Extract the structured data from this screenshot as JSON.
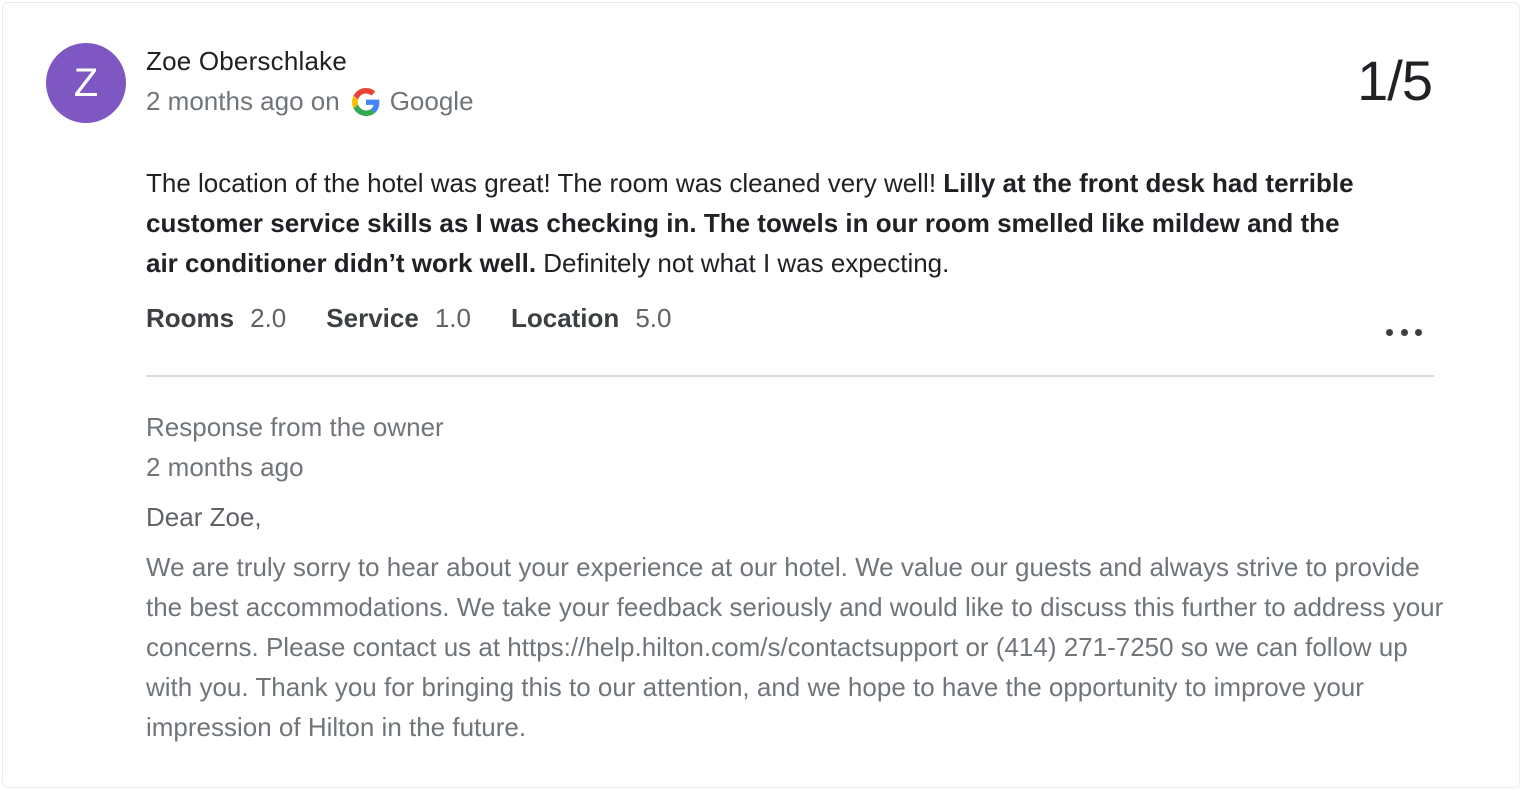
{
  "reviewer": {
    "initial": "Z",
    "name": "Zoe Oberschlake",
    "avatar_color": "#7e57c2"
  },
  "meta": {
    "time_prefix": "2 months ago on",
    "source_icon": "google-g-icon",
    "source": "Google"
  },
  "score": "1/5",
  "review": {
    "text_plain_start": "The location of the hotel was great! The room was cleaned very well! ",
    "text_bold": "Lilly at the front desk had terrible customer service skills as I was checking in. The towels in our room smelled like mildew and the air conditioner didn’t work well.",
    "text_plain_end": " Definitely not what I was expecting."
  },
  "ratings": [
    {
      "label": "Rooms",
      "value": "2.0"
    },
    {
      "label": "Service",
      "value": "1.0"
    },
    {
      "label": "Location",
      "value": "5.0"
    }
  ],
  "more_icon": "more-horizontal-icon",
  "response": {
    "heading": "Response from the owner",
    "time": "2 months ago",
    "greeting": "Dear Zoe,",
    "body": "We are truly sorry to hear about your experience at our hotel. We value our guests and always strive to provide the best accommodations. We take your feedback seriously and would like to discuss this further to address your concerns. Please contact us at https://help.hilton.com/s/contactsupport or (414) 271-7250 so we can follow up with you. Thank you for bringing this to our attention, and we hope to have the opportunity to improve your impression of Hilton in the future."
  },
  "colors": {
    "text_primary": "#202124",
    "text_secondary": "#70757a",
    "divider": "#dadce0"
  }
}
